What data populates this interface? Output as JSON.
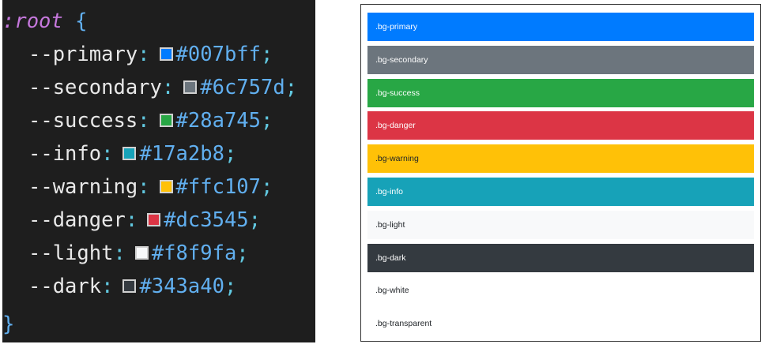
{
  "code": {
    "selector": ":root",
    "open_brace": "{",
    "close_brace": "}",
    "variables": [
      {
        "name": "--primary",
        "value": "#007bff"
      },
      {
        "name": "--secondary",
        "value": "#6c757d"
      },
      {
        "name": "--success",
        "value": "#28a745"
      },
      {
        "name": "--info",
        "value": "#17a2b8"
      },
      {
        "name": "--warning",
        "value": "#ffc107"
      },
      {
        "name": "--danger",
        "value": "#dc3545"
      },
      {
        "name": "--light",
        "value": "#f8f9fa"
      },
      {
        "name": "--dark",
        "value": "#343a40"
      }
    ]
  },
  "preview": {
    "rows": [
      {
        "label": ".bg-primary",
        "bg": "#007bff",
        "fg": "#ffffff"
      },
      {
        "label": ".bg-secondary",
        "bg": "#6c757d",
        "fg": "#ffffff"
      },
      {
        "label": ".bg-success",
        "bg": "#28a745",
        "fg": "#ffffff"
      },
      {
        "label": ".bg-danger",
        "bg": "#dc3545",
        "fg": "#ffffff"
      },
      {
        "label": ".bg-warning",
        "bg": "#ffc107",
        "fg": "#212529"
      },
      {
        "label": ".bg-info",
        "bg": "#17a2b8",
        "fg": "#ffffff"
      },
      {
        "label": ".bg-light",
        "bg": "#f8f9fa",
        "fg": "#212529"
      },
      {
        "label": ".bg-dark",
        "bg": "#343a40",
        "fg": "#ffffff"
      },
      {
        "label": ".bg-white",
        "bg": "#ffffff",
        "fg": "#212529"
      },
      {
        "label": ".bg-transparent",
        "bg": "transparent",
        "fg": "#212529"
      }
    ]
  }
}
